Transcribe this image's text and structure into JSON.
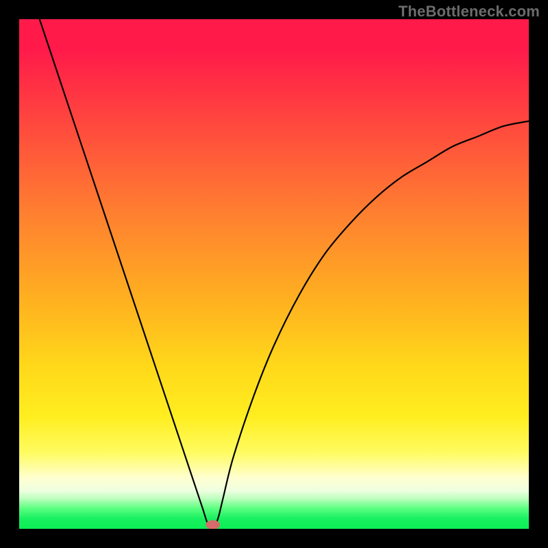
{
  "brand": "TheBottleneck.com",
  "colors": {
    "page_bg": "#000000",
    "curve_stroke": "#000000",
    "marker_fill": "#d66b6b"
  },
  "chart_data": {
    "type": "line",
    "title": "",
    "xlabel": "",
    "ylabel": "",
    "xlim": [
      0,
      100
    ],
    "ylim": [
      0,
      100
    ],
    "grid": false,
    "legend": false,
    "series": [
      {
        "name": "bottleneck-curve",
        "x": [
          4,
          8,
          12,
          16,
          20,
          24,
          28,
          32,
          34,
          36,
          37,
          38,
          39,
          40,
          42,
          46,
          50,
          55,
          60,
          65,
          70,
          75,
          80,
          85,
          90,
          95,
          100
        ],
        "values": [
          100,
          88,
          76,
          64,
          52,
          40,
          28,
          16,
          10,
          4,
          1,
          0,
          2,
          6,
          14,
          26,
          36,
          46,
          54,
          60,
          65,
          69,
          72,
          75,
          77,
          79,
          80
        ]
      }
    ],
    "marker": {
      "x": 38,
      "y": 0.8,
      "rx": 1.4,
      "ry": 0.9
    }
  }
}
